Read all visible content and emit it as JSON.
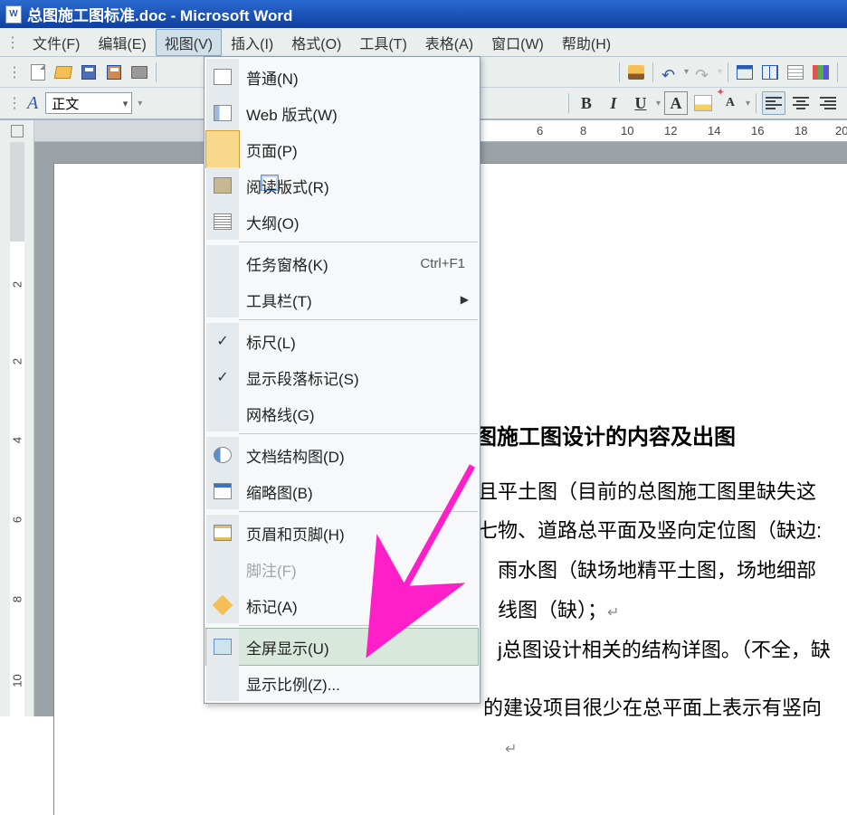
{
  "title": "总图施工图标准.doc - Microsoft Word",
  "menubar": {
    "file": "文件(F)",
    "edit": "编辑(E)",
    "view": "视图(V)",
    "insert": "插入(I)",
    "format": "格式(O)",
    "tools": "工具(T)",
    "table": "表格(A)",
    "window": "窗口(W)",
    "help": "帮助(H)"
  },
  "fmtbar": {
    "style": "正文",
    "b": "B",
    "i": "I",
    "u": "U",
    "a1": "A",
    "a2": "A"
  },
  "view_menu": {
    "normal": "普通(N)",
    "web": "Web 版式(W)",
    "page": "页面(P)",
    "reading": "阅读版式(R)",
    "outline": "大纲(O)",
    "taskpane": "任务窗格(K)",
    "taskpane_sc": "Ctrl+F1",
    "toolbars": "工具栏(T)",
    "ruler": "标尺(L)",
    "show_para": "显示段落标记(S)",
    "gridlines": "网格线(G)",
    "docmap": "文档结构图(D)",
    "thumbs": "缩略图(B)",
    "headerfooter": "页眉和页脚(H)",
    "footnote": "脚注(F)",
    "markup": "标记(A)",
    "fullscreen": "全屏显示(U)",
    "zoom": "显示比例(Z)..."
  },
  "ruler": {
    "marks": [
      "6",
      "8",
      "10",
      "12",
      "14",
      "16",
      "18",
      "20"
    ]
  },
  "vruler": {
    "marks": [
      "2",
      "2",
      "4",
      "6",
      "8",
      "10"
    ]
  },
  "doc": {
    "title": "图施工图设计的内容及出图",
    "l1": "且平土图（目前的总图施工图里缺失这",
    "l2": "七物、道路总平面及竖向定位图（缺边:",
    "l3": "雨水图（缺场地精平土图，场地细部",
    "l4": "线图（缺）；",
    "l5": "j总图设计相关的结构详图。（不全，缺",
    "l6": "的建设项目很少在总平面上表示有竖向",
    "ret": "↵"
  }
}
